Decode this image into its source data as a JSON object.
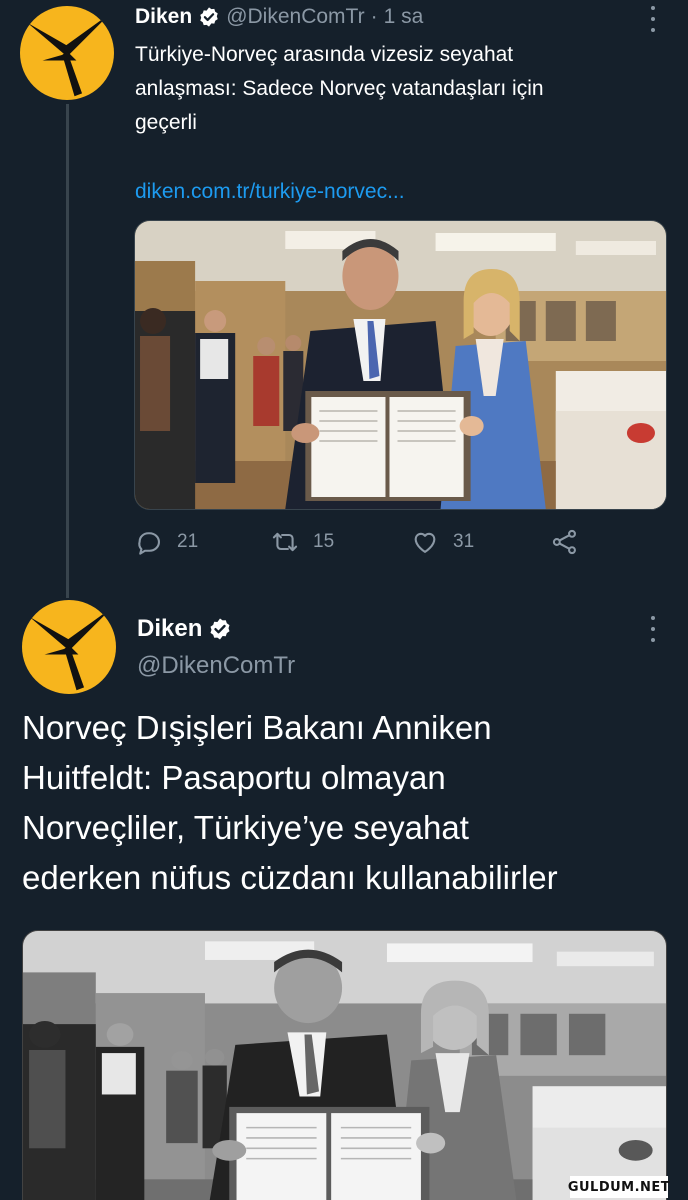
{
  "tweet1": {
    "author_name": "Diken",
    "handle": "@DikenComTr",
    "separator": "·",
    "time": "1 sa",
    "text_lines": [
      "Türkiye-Norveç arasında vizesiz seyahat",
      "anlaşması: Sadece Norveç vatandaşları için",
      "geçerli"
    ],
    "link": "diken.com.tr/turkiye-norvec...",
    "stats": {
      "replies": "21",
      "retweets": "15",
      "likes": "31"
    }
  },
  "tweet2": {
    "author_name": "Diken",
    "handle": "@DikenComTr",
    "text_lines": [
      "Norveç Dışişleri Bakanı Anniken",
      "Huitfeldt: Pasaportu olmayan",
      "Norveçliler, Türkiye’ye seyahat",
      "ederken nüfus cüzdanı kullanabilirler"
    ]
  },
  "watermark": "GULDUM.NET",
  "colors": {
    "background": "#15202b",
    "avatar": "#f7b51d",
    "link": "#1d9bf0",
    "muted": "#8b98a5",
    "verified": "#ffffff"
  },
  "icons": [
    "diken-logo-icon",
    "verified-badge-icon",
    "more-icon",
    "reply-icon",
    "retweet-icon",
    "like-icon",
    "share-icon"
  ]
}
